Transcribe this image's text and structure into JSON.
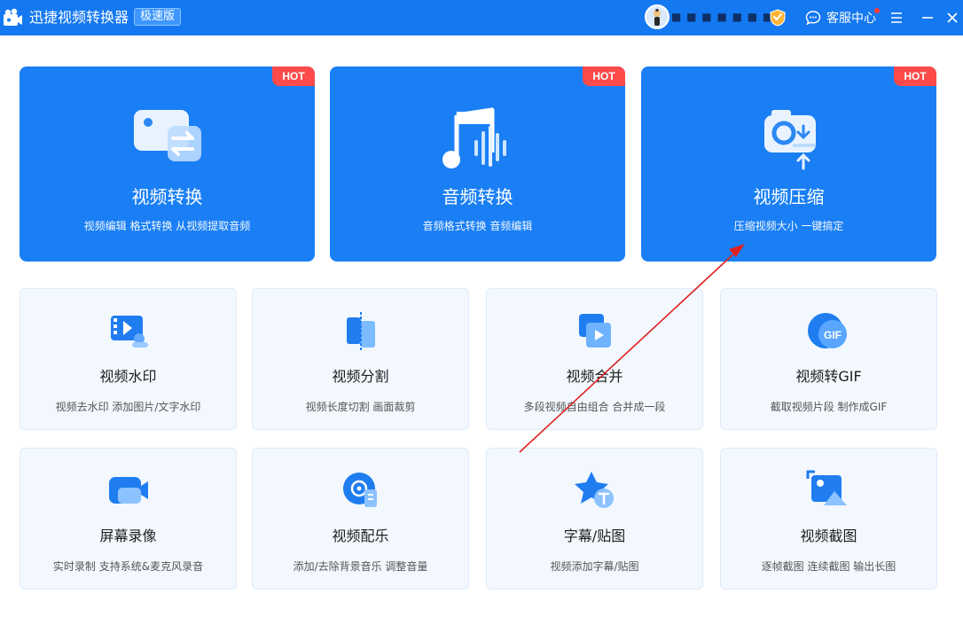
{
  "app": {
    "title": "迅捷视频转换器",
    "edition": "极速版",
    "username": "■ ■ ■ ■ ■ ■ ■ l",
    "service_label": "客服中心"
  },
  "colors": {
    "brand": "#1478f0",
    "hot": "#ff4a4a",
    "card_bg": "#f2f8fe",
    "annotation_arrow": "#e02020"
  },
  "features": [
    {
      "title": "视频转换",
      "subtitle": "视频编辑 格式转换 从视频提取音频",
      "badge": "HOT",
      "icon": "video-convert-icon"
    },
    {
      "title": "音频转换",
      "subtitle": "音频格式转换 音频编辑",
      "badge": "HOT",
      "icon": "audio-convert-icon"
    },
    {
      "title": "视频压缩",
      "subtitle": "压缩视频大小 一键搞定",
      "badge": "HOT",
      "icon": "video-compress-icon"
    }
  ],
  "tools": [
    {
      "title": "视频水印",
      "subtitle": "视频去水印 添加图片/文字水印",
      "icon": "video-watermark-icon"
    },
    {
      "title": "视频分割",
      "subtitle": "视频长度切割 画面裁剪",
      "icon": "video-split-icon"
    },
    {
      "title": "视频合并",
      "subtitle": "多段视频自由组合 合并成一段",
      "icon": "video-merge-icon"
    },
    {
      "title": "视频转GIF",
      "subtitle": "截取视频片段 制作成GIF",
      "icon": "video-to-gif-icon"
    },
    {
      "title": "屏幕录像",
      "subtitle": "实时录制 支持系统&麦克风录音",
      "icon": "screen-record-icon"
    },
    {
      "title": "视频配乐",
      "subtitle": "添加/去除背景音乐 调整音量",
      "icon": "video-music-icon"
    },
    {
      "title": "字幕/贴图",
      "subtitle": "视频添加字幕/贴图",
      "icon": "subtitle-sticker-icon"
    },
    {
      "title": "视频截图",
      "subtitle": "逐帧截图 连续截图 输出长图",
      "icon": "video-screenshot-icon"
    }
  ],
  "gif_label": "GIF"
}
